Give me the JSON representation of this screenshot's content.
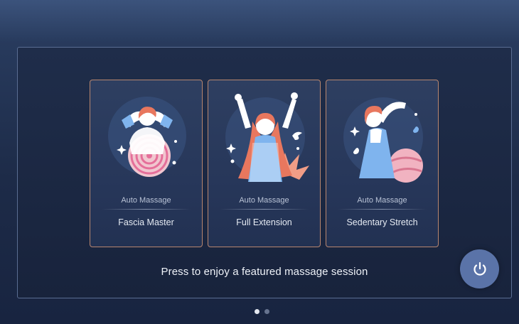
{
  "sessions": [
    {
      "kicker": "Auto Massage",
      "title": "Fascia Master",
      "icon": "fascia-master-illustration"
    },
    {
      "kicker": "Auto Massage",
      "title": "Full Extension",
      "icon": "full-extension-illustration"
    },
    {
      "kicker": "Auto Massage",
      "title": "Sedentary Stretch",
      "icon": "sedentary-stretch-illustration"
    }
  ],
  "prompt": "Press to enjoy a featured massage session",
  "power_button": {
    "icon": "power-icon"
  },
  "pagination": {
    "pages": 2,
    "current": 1
  },
  "colors": {
    "background": "#1d2b48",
    "card_border": "#b7866f",
    "accent_coral": "#e8775e",
    "accent_blue": "#7fb4ee",
    "power_button": "#5a73a8"
  }
}
